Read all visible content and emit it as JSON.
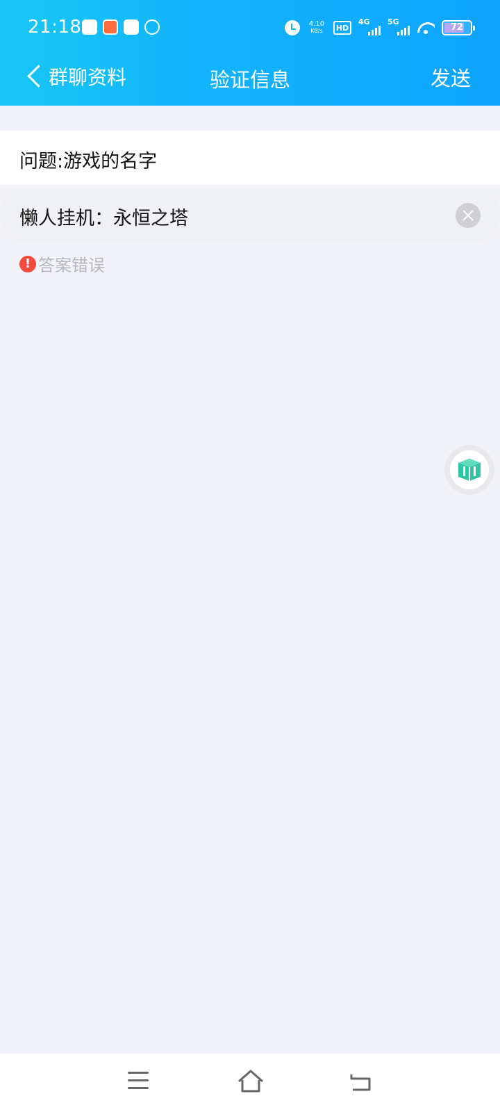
{
  "status_bar": {
    "time": "21:18",
    "network_speed": "4.10",
    "network_speed_unit": "KB/s",
    "hd_label": "HD",
    "signal_1_label": "4G",
    "signal_2_label": "5G",
    "battery_level": "72"
  },
  "navbar": {
    "back_label": "群聊资料",
    "title": "验证信息",
    "send_label": "发送"
  },
  "question": {
    "text": "问题:游戏的名字"
  },
  "answer": {
    "value": "懒人挂机：永恒之塔"
  },
  "error": {
    "icon_glyph": "!",
    "message": "答案错误"
  },
  "colors": {
    "header_gradient_start": "#19c7f6",
    "header_gradient_end": "#0ea3ff",
    "error_red": "#f24b3c",
    "page_background": "#f2f3f8",
    "floating_icon_teal": "#2fc4a2"
  },
  "icons": {
    "back": "chevron-left-icon",
    "clear": "clear-circle-icon",
    "error": "exclamation-circle-icon",
    "floating": "cube-icon",
    "nav_menu": "menu-icon",
    "nav_home": "home-icon",
    "nav_back": "back-arrow-icon"
  }
}
